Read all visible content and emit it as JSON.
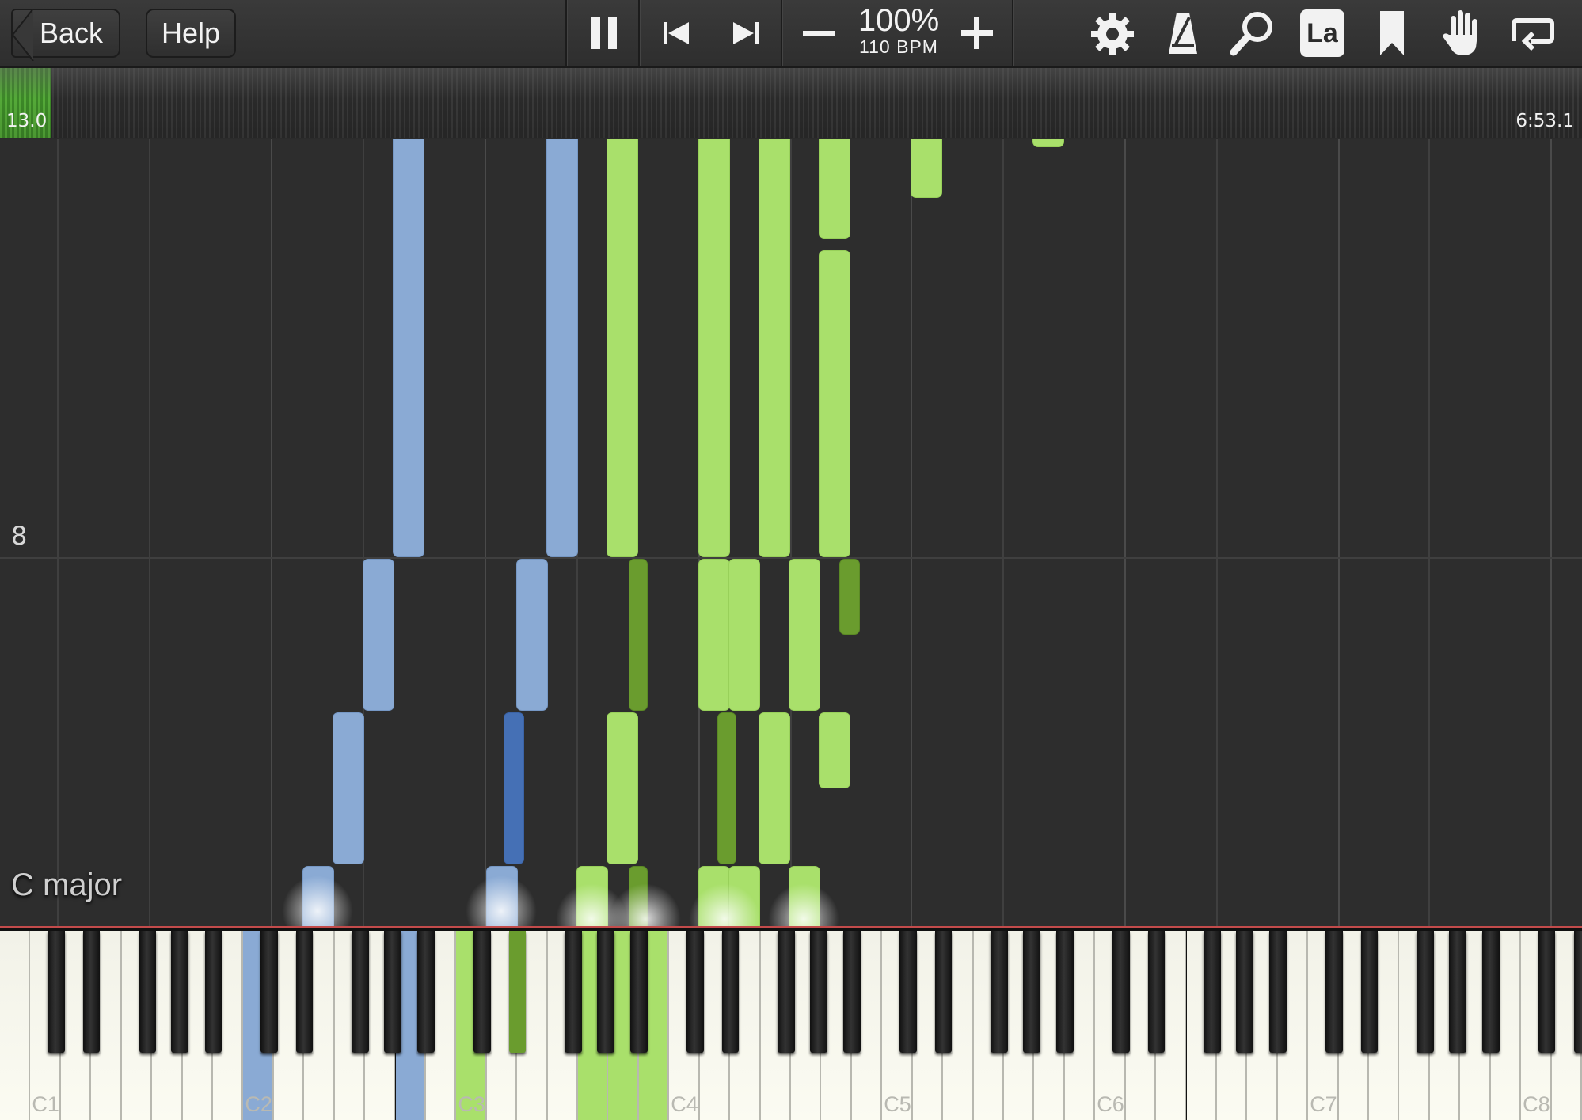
{
  "toolbar": {
    "back_label": "Back",
    "help_label": "Help",
    "tempo_percent": "100%",
    "tempo_bpm": "110 BPM",
    "icons": [
      "pause-icon",
      "skip-back-icon",
      "skip-forward-icon",
      "minus-icon",
      "plus-icon",
      "settings-gear-icon",
      "metronome-icon",
      "zoom-magnifier-icon",
      "note-labels-icon",
      "bookmark-icon",
      "hand-icon",
      "loop-icon"
    ],
    "note_labels_text": "La"
  },
  "timeline": {
    "current_time": "13.0",
    "total_time": "6:53.1",
    "progress_fraction": 0.032,
    "progress_color": "#59b83a"
  },
  "roll": {
    "measure_number": "8",
    "key_signature": "C major"
  },
  "keyboard": {
    "octave_labels": [
      "C1",
      "C2",
      "C3",
      "C4",
      "C5",
      "C6",
      "C7",
      "C8"
    ]
  },
  "colors": {
    "left_hand": "#8aaad4",
    "left_hand_dark": "#4570b5",
    "right_hand": "#a9e06b",
    "right_hand_dark": "#6a9c2e",
    "background": "#2d2d2d"
  }
}
